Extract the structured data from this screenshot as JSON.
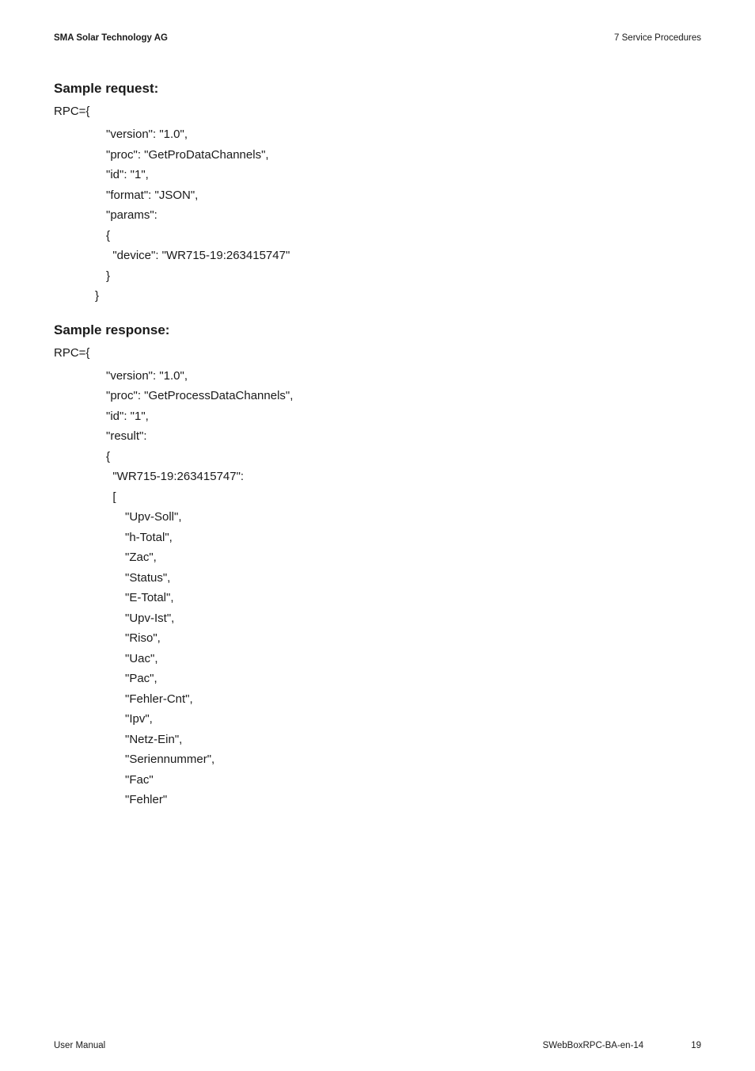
{
  "header": {
    "left": "SMA Solar Technology AG",
    "right": "7  Service Procedures"
  },
  "sections": {
    "request_heading": "Sample request:",
    "response_heading": "Sample response:",
    "rpc_prefix": "RPC={"
  },
  "request": {
    "lines": [
      "\"version\": \"1.0\",",
      "\"proc\": \"GetProDataChannels\",",
      "\"id\": \"1\",",
      "\"format\": \"JSON\",",
      "\"params\":",
      "{",
      "  \"device\": \"WR715-19:263415747\"",
      "}"
    ],
    "close": "}"
  },
  "response": {
    "top": [
      "\"version\": \"1.0\",",
      "\"proc\": \"GetProcessDataChannels\",",
      "\"id\": \"1\",",
      "\"result\":",
      "{",
      "  \"WR715-19:263415747\":",
      "  ["
    ],
    "items": [
      "\"Upv-Soll\",",
      "\"h-Total\",",
      "\"Zac\",",
      "\"Status\",",
      "\"E-Total\",",
      "\"Upv-Ist\",",
      "\"Riso\",",
      "\"Uac\",",
      "\"Pac\",",
      "\"Fehler-Cnt\",",
      "\"Ipv\",",
      "\"Netz-Ein\",",
      "\"Seriennummer\",",
      "\"Fac\"",
      "\"Fehler\""
    ]
  },
  "footer": {
    "left": "User Manual",
    "doc_id": "SWebBoxRPC-BA-en-14",
    "page": "19"
  }
}
